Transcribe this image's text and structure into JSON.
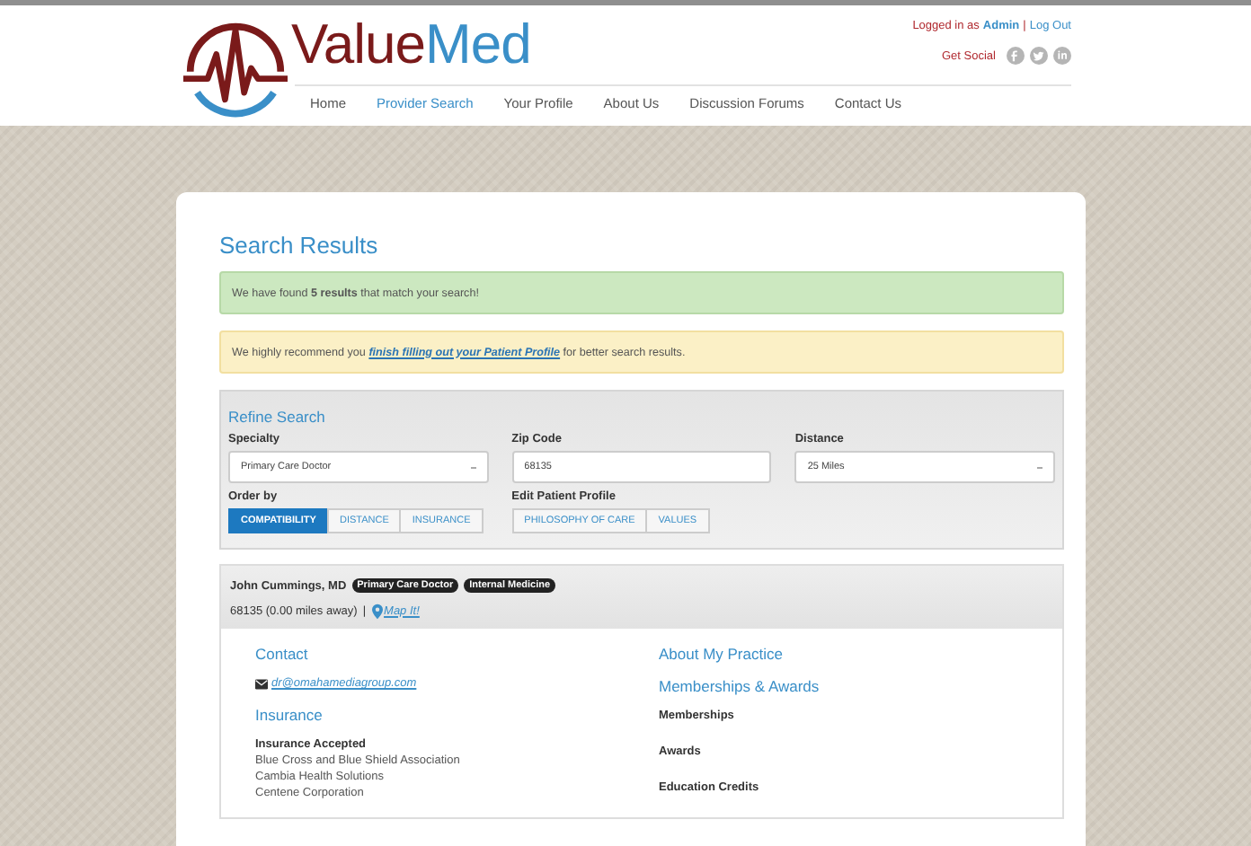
{
  "header": {
    "logo": {
      "part1": "Value",
      "part2": "Med"
    },
    "login": {
      "prefix": "Logged in as",
      "user": "Admin",
      "separator": "|",
      "logout": "Log Out"
    },
    "social": {
      "label": "Get Social"
    },
    "nav": [
      {
        "label": "Home",
        "selected": false
      },
      {
        "label": "Provider Search",
        "selected": true
      },
      {
        "label": "Your Profile",
        "selected": false
      },
      {
        "label": "About Us",
        "selected": false
      },
      {
        "label": "Discussion Forums",
        "selected": false
      },
      {
        "label": "Contact Us",
        "selected": false
      }
    ]
  },
  "title": "Search Results",
  "alerts": [
    {
      "kind": "success",
      "text": "We have found **5 results** that match your search!"
    },
    {
      "kind": "warning",
      "text": "We highly recommend you",
      "link": "finish filling out your Patient Profile",
      "after": "for better search results."
    }
  ],
  "refine": {
    "title": "Refine Search",
    "fields": [
      {
        "label": "Specialty",
        "kind": "select",
        "value": "Primary Care Doctor"
      },
      {
        "label": "Zip Code",
        "kind": "text",
        "value": "68135"
      },
      {
        "label": "Distance",
        "kind": "select",
        "value": "25 Miles"
      }
    ],
    "order_by": {
      "label": "Order by",
      "options": [
        {
          "label": "COMPATIBILITY",
          "selected": true
        },
        {
          "label": "DISTANCE",
          "selected": false
        },
        {
          "label": "INSURANCE",
          "selected": false
        }
      ]
    },
    "edit_profile": {
      "label": "Edit Patient Profile",
      "buttons": [
        "PHILOSOPHY OF CARE",
        "VALUES"
      ]
    }
  },
  "result": {
    "name": "John Cummings, MD",
    "tags": [
      "Primary Care Doctor",
      "Internal Medicine"
    ],
    "location": "68135 (0.00 miles away)",
    "separator": "|",
    "map_link": "Map It!",
    "left": [
      {
        "kind": "heading",
        "text": "Contact"
      },
      {
        "kind": "email",
        "text": "dr@omahamediagroup.com"
      },
      {
        "kind": "heading",
        "text": "Insurance"
      },
      {
        "kind": "label",
        "text": "Insurance Accepted"
      },
      {
        "kind": "item",
        "text": "Blue Cross and Blue Shield Association"
      },
      {
        "kind": "item",
        "text": "Cambia Health Solutions"
      },
      {
        "kind": "item",
        "text": "Centene Corporation"
      }
    ],
    "right": [
      {
        "kind": "heading",
        "text": "About My Practice"
      },
      {
        "kind": "heading",
        "text": "Memberships & Awards"
      },
      {
        "kind": "label",
        "text": "Memberships"
      },
      {
        "kind": "label",
        "text": "Awards"
      },
      {
        "kind": "label",
        "text": "Education Credits"
      }
    ]
  }
}
